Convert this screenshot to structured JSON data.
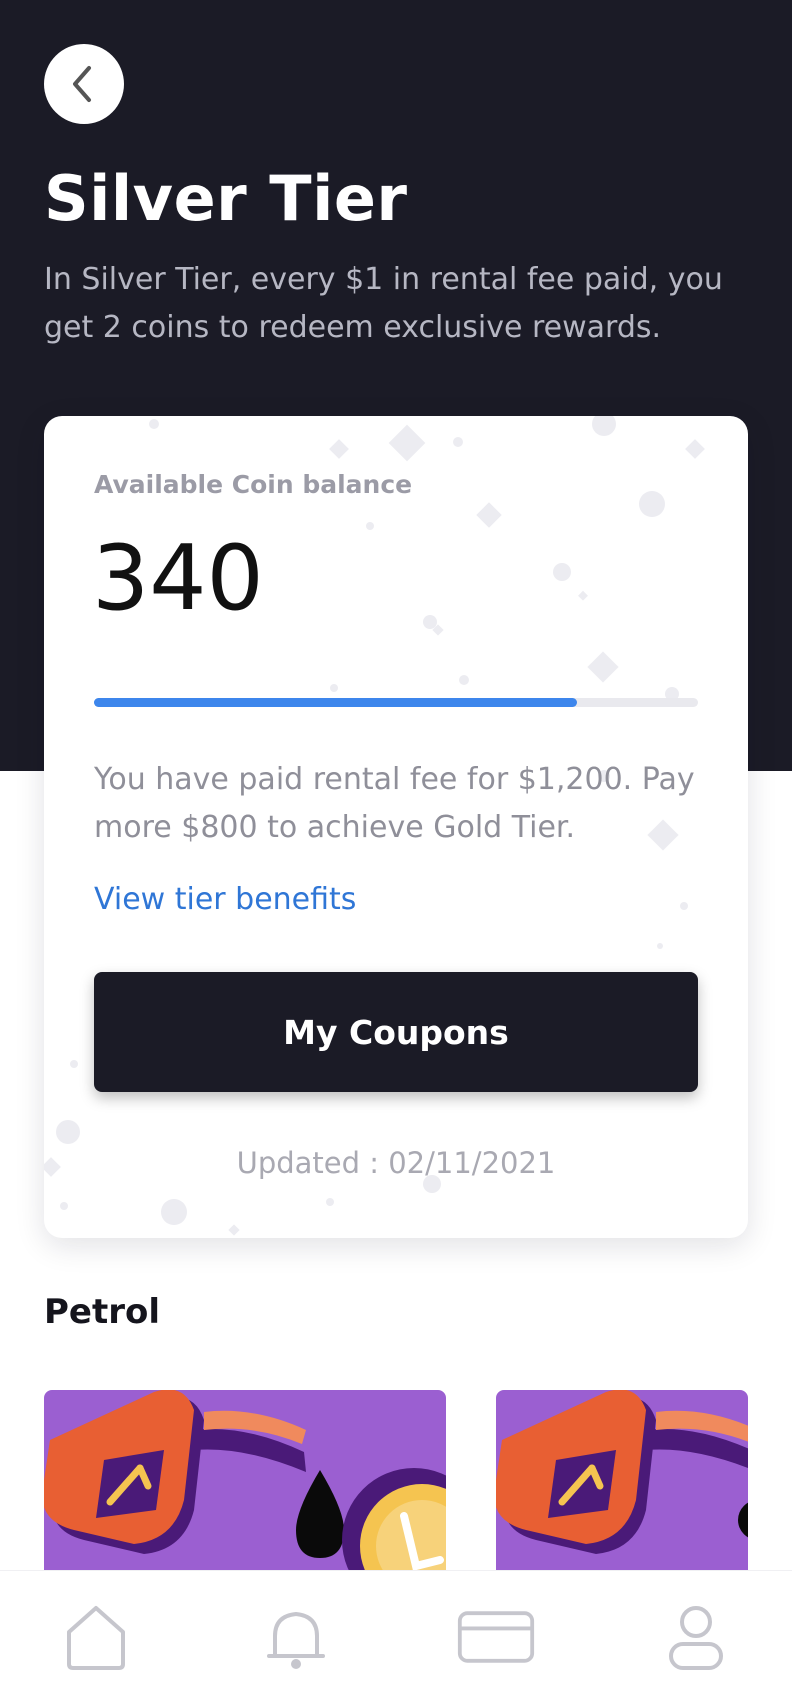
{
  "header": {
    "title": "Silver Tier",
    "description": "In Silver Tier, every $1 in rental fee paid, you get 2 coins to redeem exclusive rewards."
  },
  "balance_card": {
    "label": "Available Coin balance",
    "value": "340",
    "progress_fraction": 0.8,
    "rental_text": "You have paid rental fee for $1,200. Pay more $800 to achieve Gold Tier.",
    "benefits_link": "View tier benefits",
    "coupons_button": "My Coupons",
    "updated": "Updated : 02/11/2021"
  },
  "section": {
    "title": "Petrol"
  },
  "tabs": [
    {
      "icon": "home-icon"
    },
    {
      "icon": "bell-icon"
    },
    {
      "icon": "card-icon"
    },
    {
      "icon": "profile-icon"
    }
  ],
  "colors": {
    "header_bg": "#1b1b26",
    "accent_blue": "#3d86ec",
    "link_blue": "#2f76d6",
    "promo_purple": "#9b5fd1",
    "pump_orange": "#e85f33"
  }
}
